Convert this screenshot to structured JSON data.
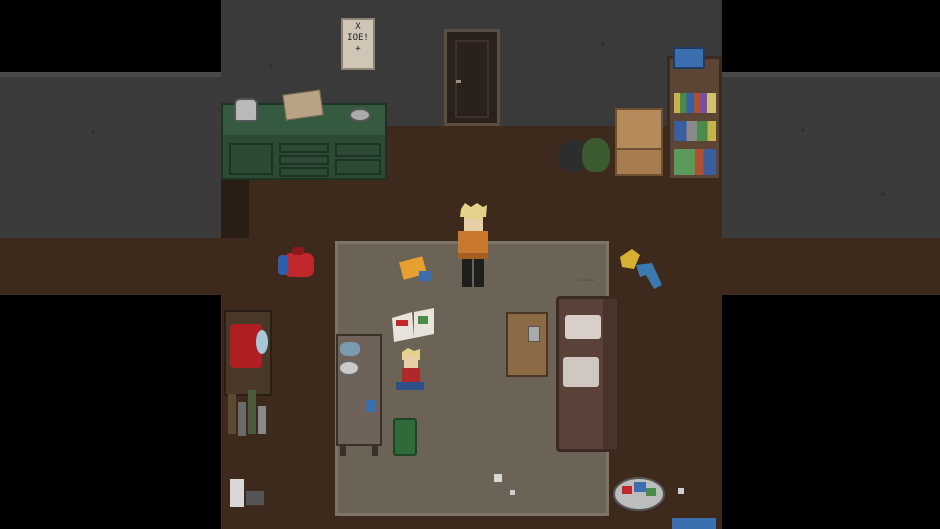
{
  "scene": {
    "poster_text": "X\nIOE!\n+",
    "rug_mark_text": "~~~"
  },
  "colors": {
    "wall": "#3a3a3a",
    "floor": "#3d2a1c",
    "rug": "#6b6356",
    "counter": "#2d4a35",
    "hoodie": "#c9792e",
    "bag_red": "#c0282c",
    "couch": "#5a4238"
  }
}
